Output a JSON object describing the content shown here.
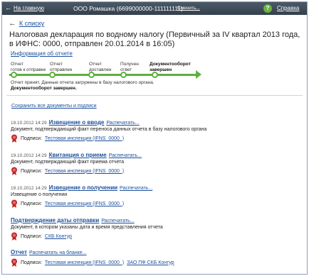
{
  "header": {
    "home": "На главную",
    "org": "ООО Ромашка (6699000000-111111111)",
    "change": "Сменить...",
    "help": "Справка",
    "help_icon": "?"
  },
  "back": "К списку",
  "title": "Налоговая декларация по водному налогу (Первичный за IV квартал 2013 года, в ИФНС: 0000, отправлен 20.01.2014 в 16:05)",
  "info_link": "Информация об отчете",
  "progress": {
    "steps": [
      {
        "line1": "Отчет",
        "line2": "готов к отправке"
      },
      {
        "line1": "Отчет",
        "line2": "отправлен"
      },
      {
        "line1": "Отчет",
        "line2": "доставлен"
      },
      {
        "line1": "Получен",
        "line2": "ответ"
      },
      {
        "line1": "Документооборот",
        "line2": "завершен"
      }
    ],
    "status": "Отчет принят. Данные отчета загружены в базу налогового органа.",
    "status_bold": "Документооборот завершен.",
    "color": "#5cb03c"
  },
  "save_all": "Сохранить все документы и подписи",
  "docs": [
    {
      "date": "19.10.2012 14:29",
      "title": "Извещение о вводе",
      "print": "Распечатать...",
      "desc": "Документ, подтверждающий факт переноса данных отчета в базу налогового органа",
      "sign_label": "Подписи:",
      "signers": [
        "Тестовая инспекция (IFNS_0000_)"
      ]
    },
    {
      "date": "19.10.2012 14:29",
      "title": "Квитанция о приеме",
      "print": "Распечатать...",
      "desc": "Документ, подтверждающий факт приема отчета",
      "sign_label": "Подписи:",
      "signers": [
        "Тестовая инспекция (IFNS_0000_)"
      ]
    },
    {
      "date": "19.10.2012 14:29",
      "title": "Извещение о получении",
      "print": "Распечатать...",
      "desc": "Извещение о получении",
      "sign_label": "Подписи:",
      "signers": [
        "Тестовая инспекция (IFNS_0000_)"
      ]
    },
    {
      "date": "",
      "title": "Подтверждение даты отправки",
      "print": "Распечатать...",
      "desc": "Документ, в котором указаны дата и время представления отчета",
      "sign_label": "Подписи:",
      "signers": [
        "СКБ Контур"
      ]
    },
    {
      "date": "",
      "title": "Отчет",
      "print": "Распечатать на бланке...",
      "desc": "",
      "sign_label": "Подписи:",
      "signers": [
        "Тестовая инспекция (IFNS_0000_)",
        "ЗАО ПФ СКБ Контур"
      ]
    }
  ]
}
